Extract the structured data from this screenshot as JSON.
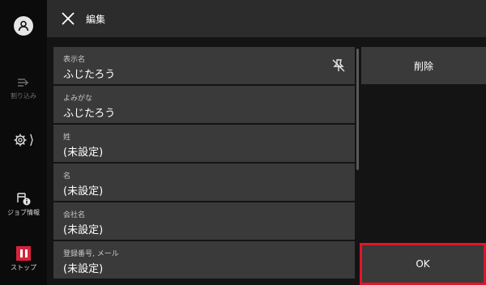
{
  "header": {
    "title": "編集"
  },
  "rail": {
    "interrupt_label": "割り込み",
    "job_label": "ジョブ情報",
    "stop_label": "ストップ"
  },
  "fields": [
    {
      "label": "表示名",
      "value": "ふじたろう"
    },
    {
      "label": "よみがな",
      "value": "ふじたろう"
    },
    {
      "label": "姓",
      "value": "(未設定)"
    },
    {
      "label": "名",
      "value": "(未設定)"
    },
    {
      "label": "会社名",
      "value": "(未設定)"
    },
    {
      "label": "登録番号, メール",
      "value": "(未設定)"
    }
  ],
  "actions": {
    "delete_label": "削除",
    "ok_label": "OK"
  },
  "colors": {
    "highlight": "#e4142a",
    "stop": "#d4243d",
    "panel": "#3a3a3a",
    "header": "#2c2c2c"
  },
  "icons": [
    "account-icon",
    "interrupt-icon",
    "gear-icon",
    "chevron-right-icon",
    "job-info-icon",
    "stop-icon",
    "close-icon",
    "pin-off-icon"
  ]
}
